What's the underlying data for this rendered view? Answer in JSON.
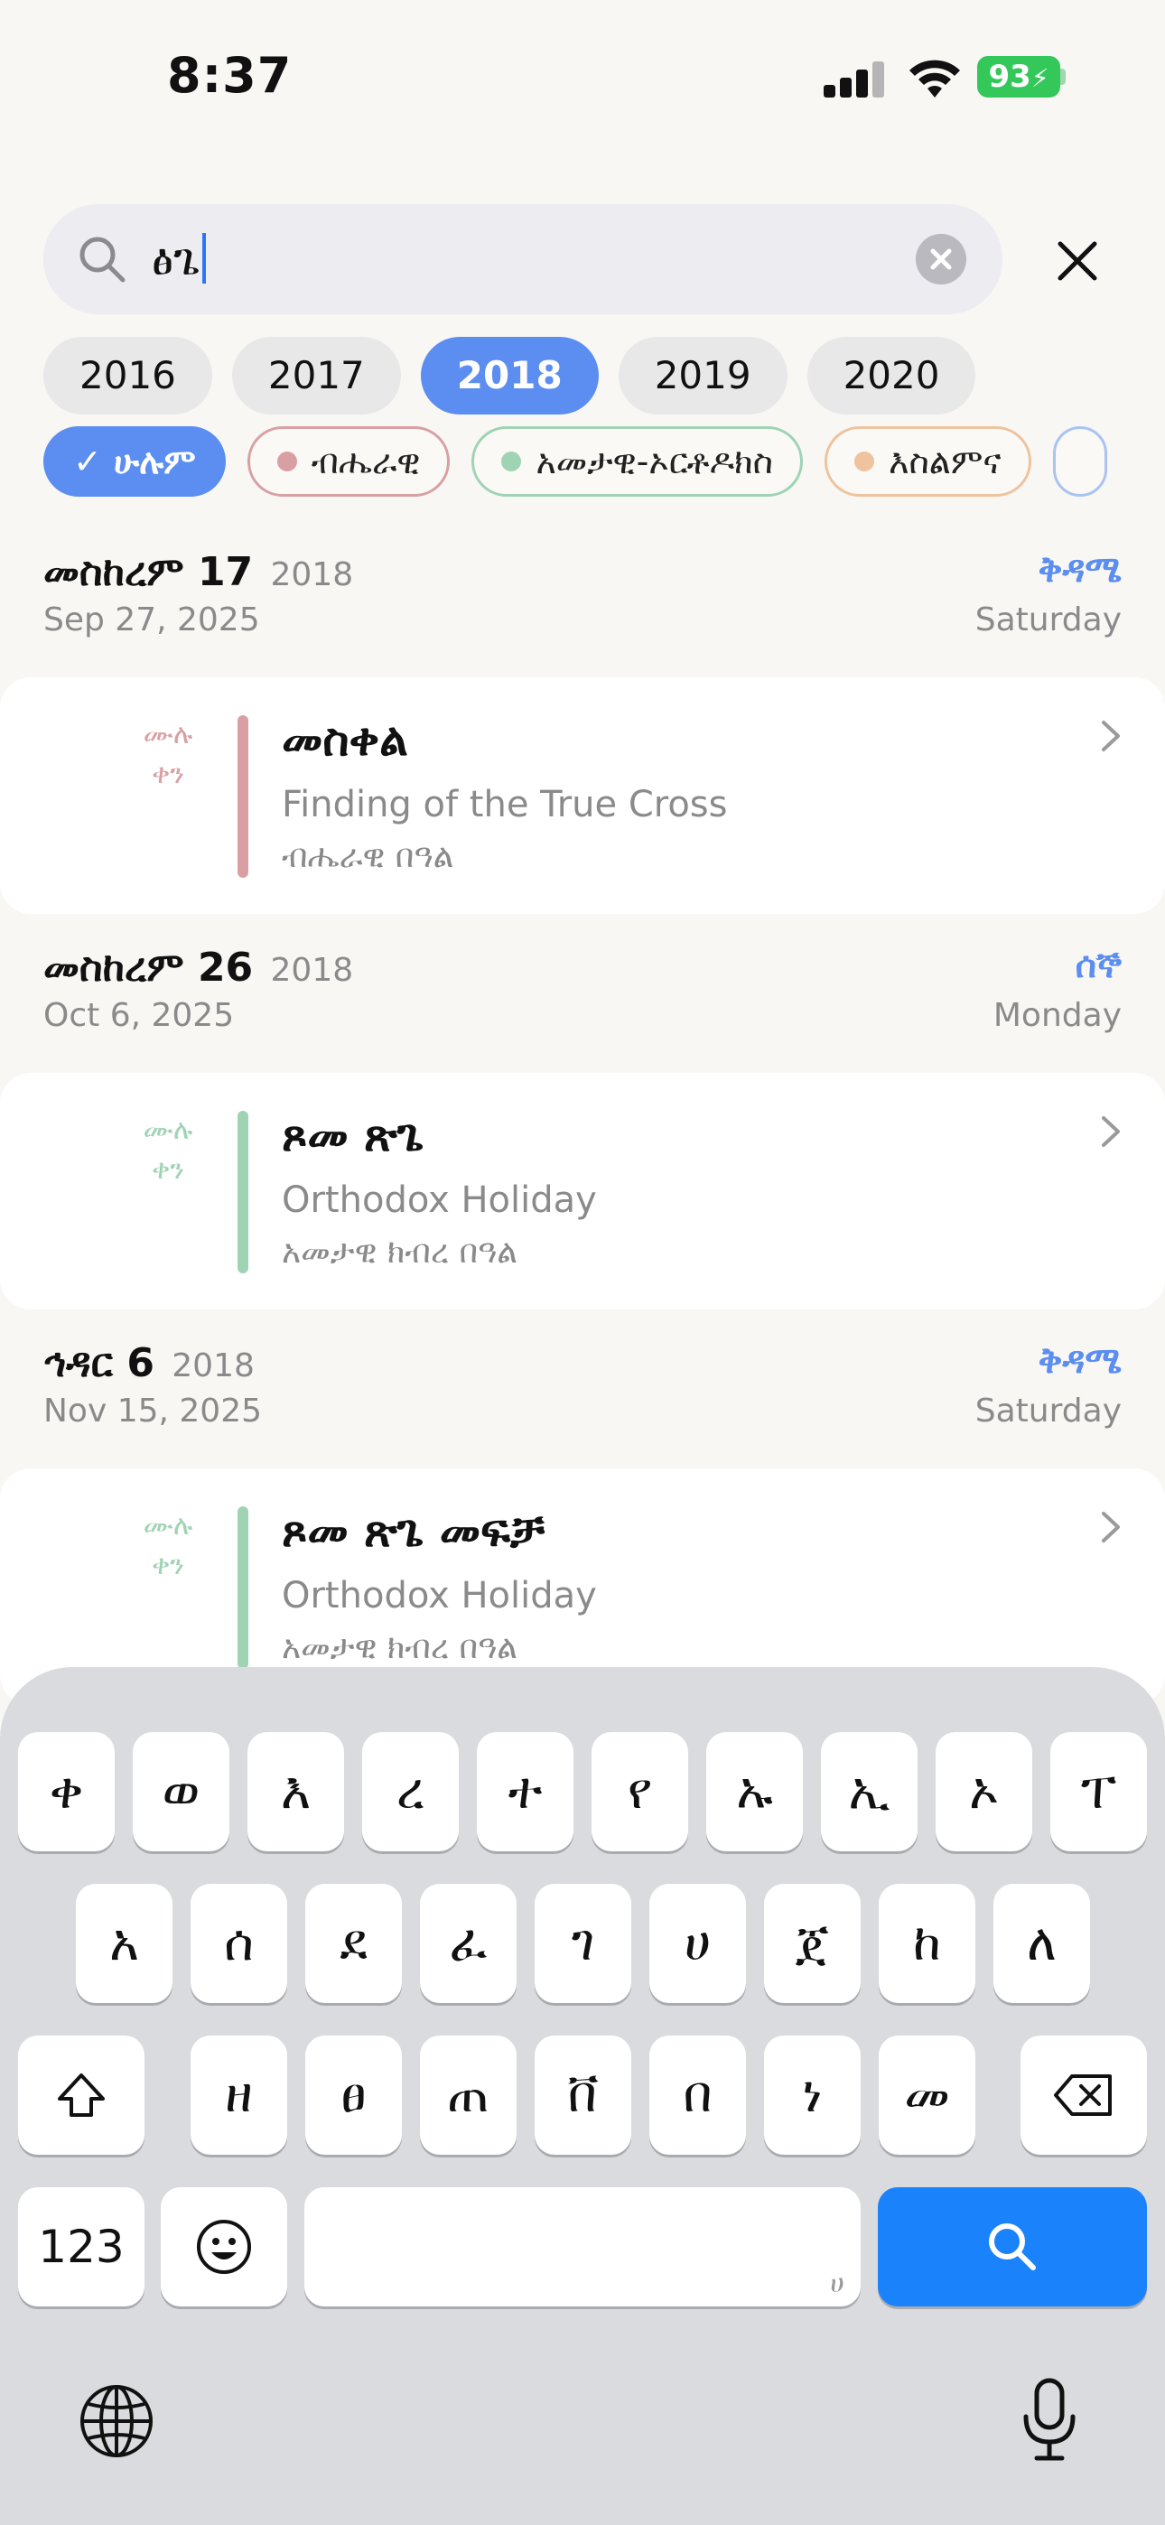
{
  "status_bar": {
    "time": "8:37",
    "battery": "93"
  },
  "search": {
    "query": "ፅጌ"
  },
  "years": [
    "2016",
    "2017",
    "2018",
    "2019",
    "2020"
  ],
  "selected_year": "2018",
  "filters": [
    {
      "label": "ሁሉም",
      "check": "✓",
      "color": "#5b8ef0"
    },
    {
      "label": "ብሔራዊ",
      "color": "#d9a0a3"
    },
    {
      "label": "አመታዊ-ኦርቶዶክስ",
      "color": "#9fd3b4"
    },
    {
      "label": "እስልምና",
      "color": "#eec39e"
    }
  ],
  "days": [
    {
      "eth_date": "መስከረም 17",
      "eth_year": "2018",
      "greg_date": "Sep 27, 2025",
      "weekday_eth": "ቅዳሜ",
      "weekday": "Saturday",
      "event": {
        "duration_line1": "ሙሉ",
        "duration_line2": "ቀን",
        "title": "መስቀል",
        "subtitle": "Finding of the True Cross",
        "type": "ብሔራዊ በዓል",
        "color": "#d9a0a3"
      }
    },
    {
      "eth_date": "መስከረም 26",
      "eth_year": "2018",
      "greg_date": "Oct 6, 2025",
      "weekday_eth": "ሰኞ",
      "weekday": "Monday",
      "event": {
        "duration_line1": "ሙሉ",
        "duration_line2": "ቀን",
        "title": "ጾመ ጽጌ",
        "subtitle": "Orthodox Holiday",
        "type": "አመታዊ ክብረ በዓል",
        "color": "#9fd3b4"
      }
    },
    {
      "eth_date": "ኅዳር 6",
      "eth_year": "2018",
      "greg_date": "Nov 15, 2025",
      "weekday_eth": "ቅዳሜ",
      "weekday": "Saturday",
      "event": {
        "duration_line1": "ሙሉ",
        "duration_line2": "ቀን",
        "title": "ጾመ ጽጌ መፍቻ",
        "subtitle": "Orthodox Holiday",
        "type": "አመታዊ ክብረ በዓል",
        "color": "#9fd3b4"
      }
    }
  ],
  "keyboard": {
    "row1": [
      "ቀ",
      "ወ",
      "እ",
      "ረ",
      "ተ",
      "የ",
      "ኡ",
      "ኢ",
      "ኦ",
      "ፐ"
    ],
    "row2": [
      "አ",
      "ሰ",
      "ደ",
      "ፈ",
      "ገ",
      "ሀ",
      "ጀ",
      "ከ",
      "ለ"
    ],
    "row3": [
      "ዘ",
      "ፀ",
      "ጠ",
      "ቨ",
      "በ",
      "ነ",
      "መ"
    ],
    "numbers_label": "123",
    "space_hint": "ሀ"
  }
}
